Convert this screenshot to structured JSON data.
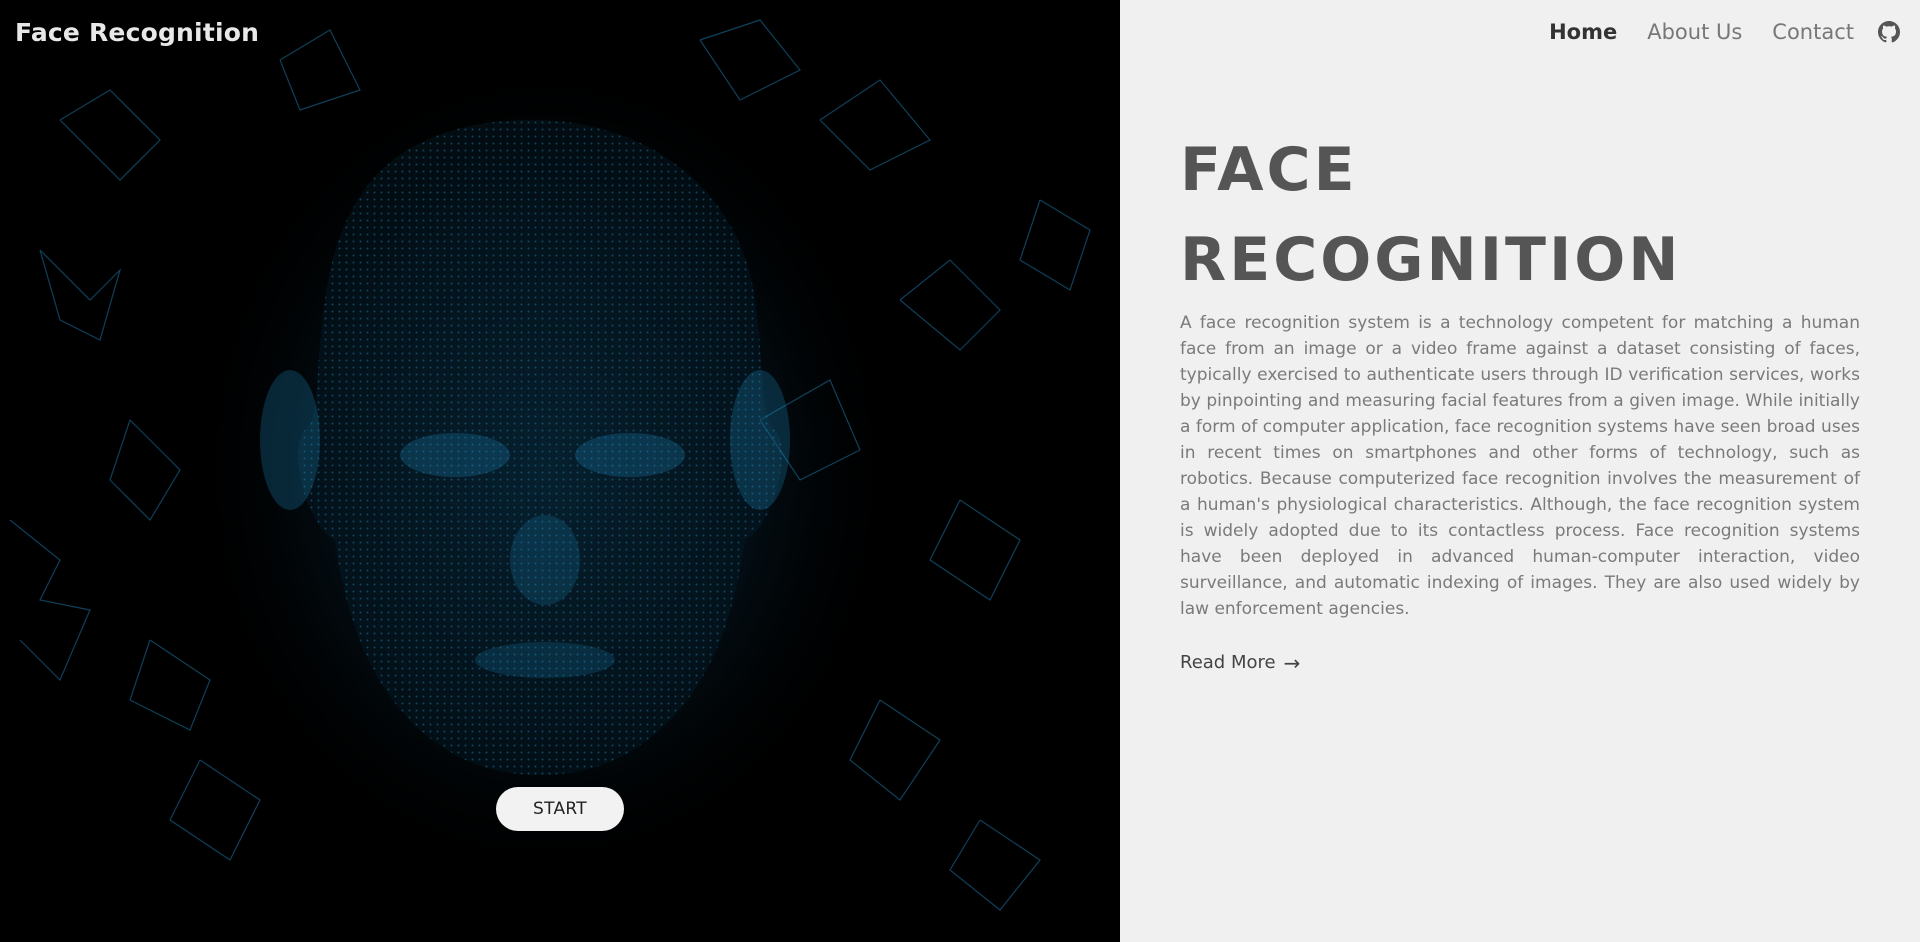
{
  "brand": {
    "title": "Face Recognition"
  },
  "nav": {
    "items": [
      {
        "label": "Home",
        "active": true
      },
      {
        "label": "About Us",
        "active": false
      },
      {
        "label": "Contact",
        "active": false
      }
    ],
    "github_icon": "github-icon"
  },
  "hero": {
    "start_label": "START",
    "background": "face-mesh-particles",
    "accent_color": "#1a8fc4"
  },
  "main": {
    "title_line1": "FACE",
    "title_line2": "RECOGNITION",
    "description": "A face recognition system is a technology competent for matching a human face from an image or a video frame against a dataset consisting of faces, typically exercised to authenticate users through ID verification services, works by pinpointing and measuring facial features from a given image. While initially a form of computer application, face recognition systems have seen broad uses in recent times on smartphones and other forms of technology, such as robotics. Because computerized face recognition involves the measurement of a human's physiological characteristics. Although, the face recognition system is widely adopted due to its contactless process. Face recognition systems have been deployed in advanced human-computer interaction, video surveillance, and automatic indexing of images. They are also used widely by law enforcement agencies.",
    "read_more_label": "Read More",
    "read_more_icon": "arrow-right-icon"
  },
  "colors": {
    "hero_bg": "#000000",
    "panel_bg": "#f0f0f0",
    "title": "#555555",
    "body_text": "#7a7a7a"
  }
}
